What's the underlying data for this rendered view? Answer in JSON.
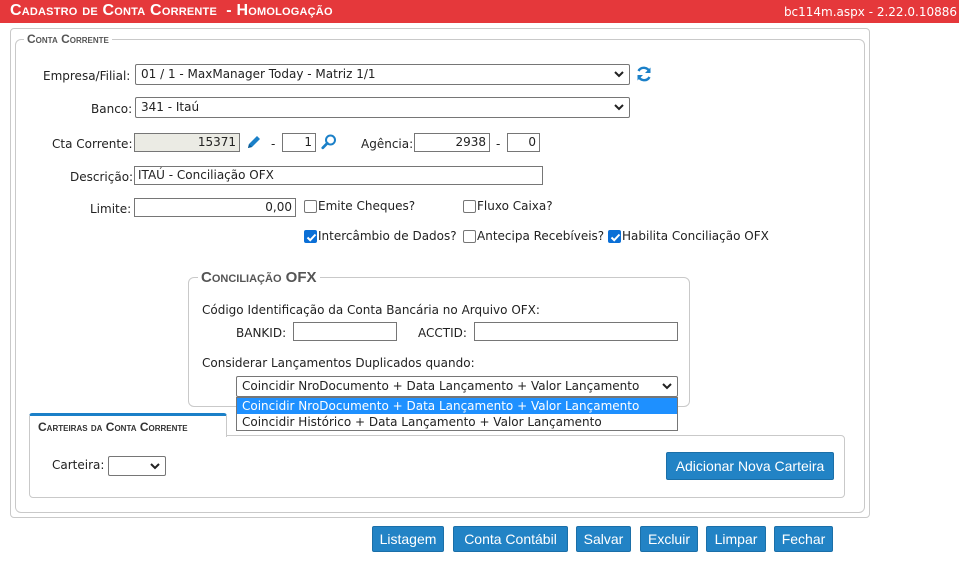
{
  "window": {
    "title": "Cadastro de Conta Corrente  - Homologação",
    "version": "bc114m.aspx - 2.22.0.10886"
  },
  "section": {
    "legend": "Conta Corrente"
  },
  "form": {
    "empresa": {
      "label": "Empresa/Filial:",
      "value": "01 / 1 - MaxManager Today - Matriz 1/1"
    },
    "banco": {
      "label": "Banco:",
      "value": "341 - Itaú"
    },
    "cta_corrente": {
      "label": "Cta Corrente:",
      "value": "15371",
      "separator": "-",
      "digit": "1"
    },
    "agencia": {
      "label": "Agência:",
      "value": "2938",
      "separator": "-",
      "digit": "0"
    },
    "descricao": {
      "label": "Descrição:",
      "value": "ITAÚ - Conciliação OFX"
    },
    "limite": {
      "label": "Limite:",
      "value": "0,00"
    },
    "checkboxes": {
      "emite_cheques": {
        "label": "Emite Cheques?",
        "checked": false
      },
      "fluxo_caixa": {
        "label": "Fluxo Caixa?",
        "checked": false
      },
      "intercambio": {
        "label": "Intercâmbio de Dados?",
        "checked": true
      },
      "antecipa": {
        "label": "Antecipa Recebíveis?",
        "checked": false
      },
      "habilita_ofx": {
        "label": "Habilita Conciliação OFX",
        "checked": true
      }
    }
  },
  "ofx": {
    "legend": "Conciliação OFX",
    "codigo_label": "Código Identificação da Conta Bancária no Arquivo OFX:",
    "bankid_label": "BANKID:",
    "bankid_value": "",
    "acctid_label": "ACCTID:",
    "acctid_value": "",
    "duplicados_label": "Considerar Lançamentos Duplicados quando:",
    "duplicados_value": "Coincidir NroDocumento + Data Lançamento + Valor Lançamento",
    "options": [
      "Coincidir NroDocumento + Data Lançamento + Valor Lançamento",
      "Coincidir Histórico + Data Lançamento + Valor Lançamento"
    ]
  },
  "carteiras": {
    "tab_label": "Carteiras da Conta Corrente",
    "carteira_label": "Carteira:",
    "carteira_value": "",
    "add_button": "Adicionar Nova Carteira"
  },
  "toolbar": {
    "listagem": "Listagem",
    "conta_contabil": "Conta Contábil",
    "salvar": "Salvar",
    "excluir": "Excluir",
    "limpar": "Limpar",
    "fechar": "Fechar"
  },
  "colors": {
    "title_bar": "#e5383b",
    "button": "#2283c5",
    "accent": "#1b80c8",
    "checkbox": "#0b6fd6"
  }
}
